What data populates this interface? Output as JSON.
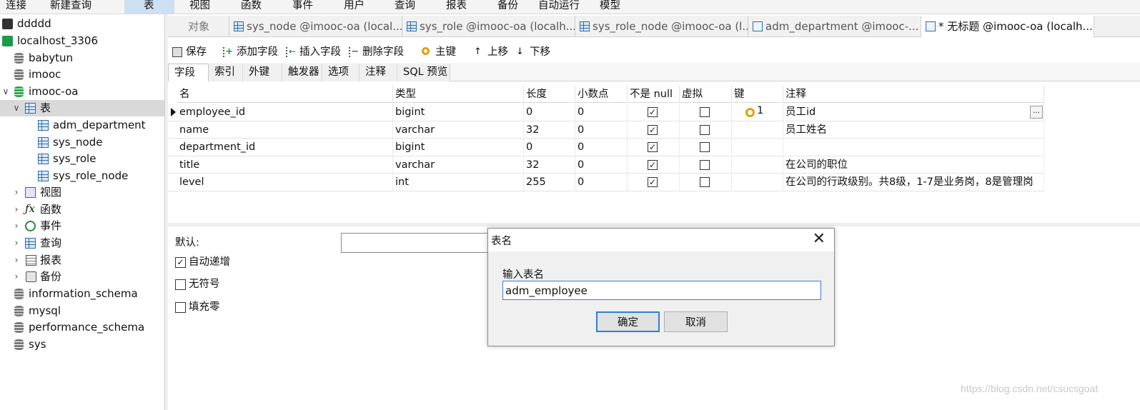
{
  "menu": [
    "连接",
    "新建查询",
    "表",
    "视图",
    "函数",
    "事件",
    "用户",
    "查询",
    "报表",
    "备份",
    "自动运行",
    "模型"
  ],
  "tree": {
    "connections": [
      "ddddd",
      "localhost_3306"
    ],
    "databases_top": [
      "babytun",
      "imooc",
      "imooc-oa"
    ],
    "tables_group": "表",
    "tables": [
      "adm_department",
      "sys_node",
      "sys_role",
      "sys_role_node"
    ],
    "groups": [
      "视图",
      "函数",
      "事件",
      "查询",
      "报表",
      "备份"
    ],
    "databases_bottom": [
      "information_schema",
      "mysql",
      "performance_schema",
      "sys"
    ]
  },
  "tabs": {
    "objects": "对象",
    "items": [
      "sys_node @imooc-oa (local...",
      "sys_role @imooc-oa (localh...",
      "sys_role_node @imooc-oa (l...",
      "adm_department @imooc-...",
      "* 无标题 @imooc-oa (localh..."
    ]
  },
  "toolbar": {
    "save": "保存",
    "add_field": "添加字段",
    "insert_field": "插入字段",
    "delete_field": "删除字段",
    "primary_key": "主键",
    "move_up": "上移",
    "move_down": "下移"
  },
  "subtabs": [
    "字段",
    "索引",
    "外键",
    "触发器",
    "选项",
    "注释",
    "SQL 预览"
  ],
  "grid": {
    "headers": [
      "名",
      "类型",
      "长度",
      "小数点",
      "不是 null",
      "虚拟",
      "键",
      "注释"
    ],
    "rows": [
      {
        "name": "employee_id",
        "type": "bigint",
        "length": "0",
        "decimals": "0",
        "not_null": true,
        "virtual": false,
        "key": "1",
        "comment": "员工id"
      },
      {
        "name": "name",
        "type": "varchar",
        "length": "32",
        "decimals": "0",
        "not_null": true,
        "virtual": false,
        "key": "",
        "comment": "员工姓名"
      },
      {
        "name": "department_id",
        "type": "bigint",
        "length": "0",
        "decimals": "0",
        "not_null": true,
        "virtual": false,
        "key": "",
        "comment": ""
      },
      {
        "name": "title",
        "type": "varchar",
        "length": "32",
        "decimals": "0",
        "not_null": true,
        "virtual": false,
        "key": "",
        "comment": "在公司的职位"
      },
      {
        "name": "level",
        "type": "int",
        "length": "255",
        "decimals": "0",
        "not_null": true,
        "virtual": false,
        "key": "",
        "comment": "在公司的行政级别。共8级，1-7是业务岗，8是管理岗"
      }
    ],
    "more_button": "..."
  },
  "props": {
    "default_label": "默认:",
    "auto_increment": "自动递增",
    "auto_increment_checked": true,
    "unsigned": "无符号",
    "unsigned_checked": false,
    "zerofill": "填充零",
    "zerofill_checked": false
  },
  "dialog": {
    "title": "表名",
    "prompt": "输入表名",
    "value": "adm_employee",
    "ok": "确定",
    "cancel": "取消"
  },
  "watermark": "https://blog.csdn.net/csucsgoat"
}
